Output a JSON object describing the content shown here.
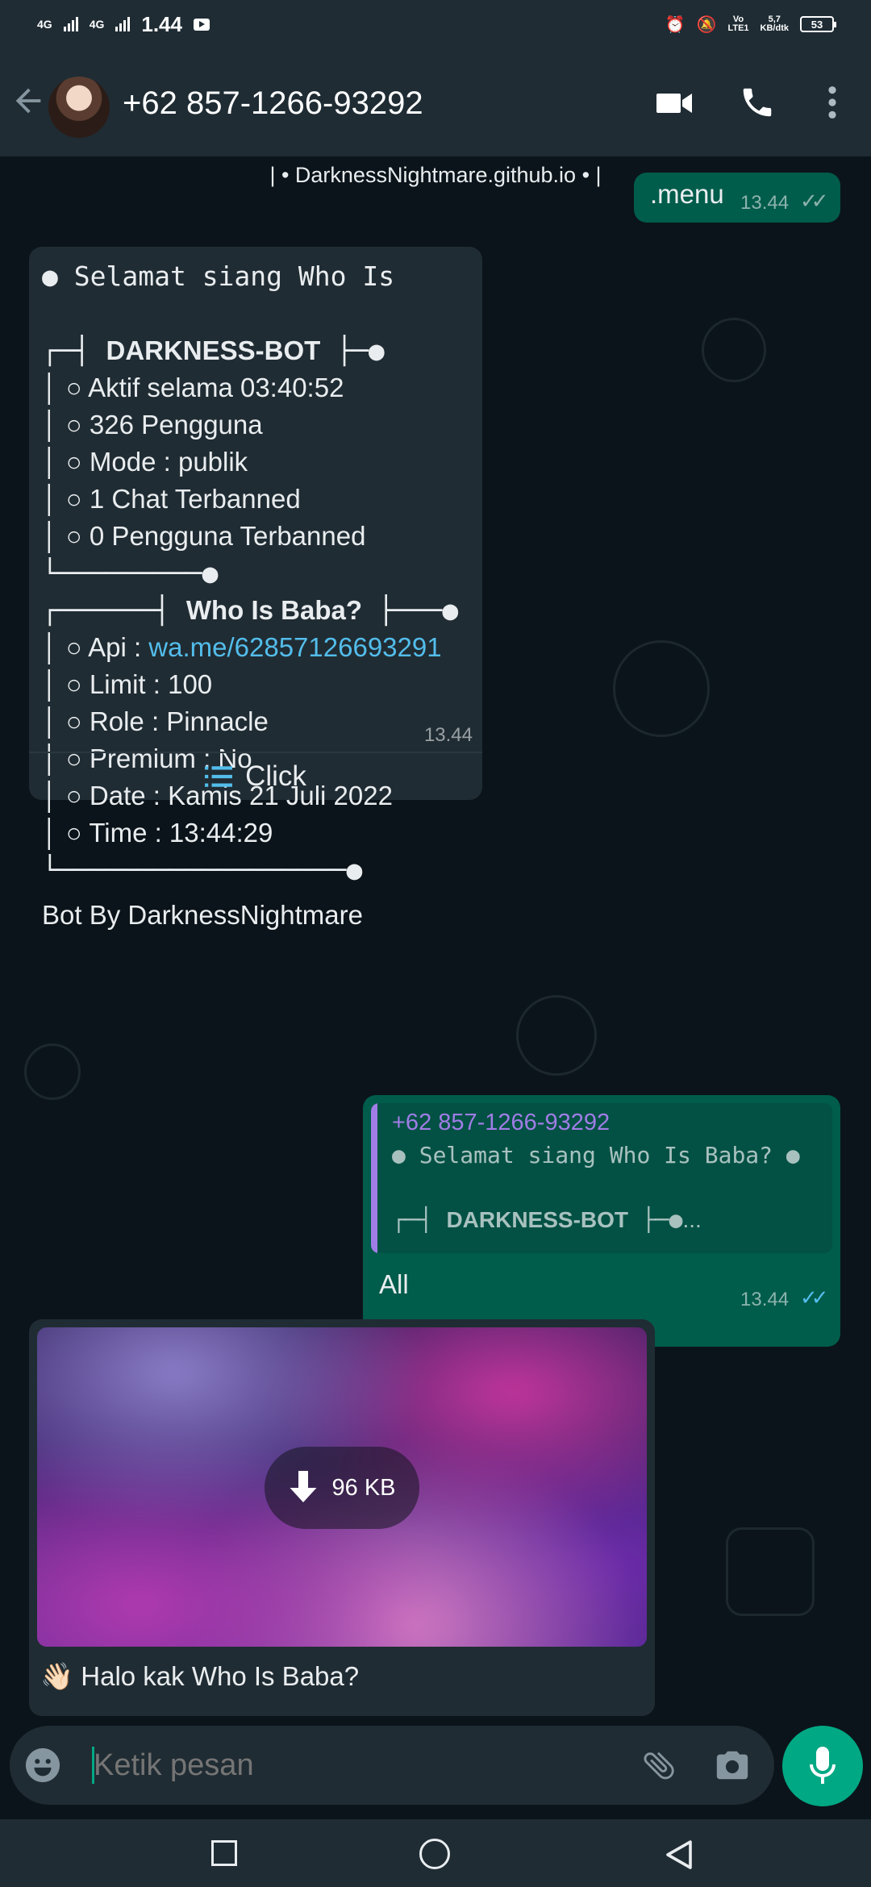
{
  "status_bar": {
    "network_1": "4G",
    "network_2": "4G",
    "time": "1.44",
    "volte_label": "Vo\nLTE1",
    "speed_label": "5,7\nKB/dtk",
    "battery": "53"
  },
  "header": {
    "contact": "+62 857-1266-93292"
  },
  "banner": "| • DarknessNightmare.github.io • |",
  "outgoing_menu": {
    "text": ".menu",
    "time": "13.44"
  },
  "bot_menu": {
    "greeting": "Selamat siang Who Is",
    "section1_title": "DARKNESS-BOT",
    "section1_lines": [
      "Aktif selama 03:40:52",
      "326 Pengguna",
      "Mode : publik",
      "1 Chat Terbanned",
      "0 Pengguna Terbanned"
    ],
    "section2_title": "Who Is Baba?",
    "api_label": "Api : ",
    "api_link": "wa.me/62857126693291",
    "section2_lines": [
      "Limit : 100",
      "Role : Pinnacle",
      "Premium : No",
      "Date : Kamis 21 Juli 2022",
      "Time : 13:44:29"
    ],
    "footer": "Bot By DarknessNightmare",
    "time": "13.44",
    "button_label": "Click"
  },
  "reply_message": {
    "quoted_sender": "+62 857-1266-93292",
    "quoted_line1": "Selamat siang Who Is Baba?",
    "quoted_line2_title": "DARKNESS-BOT",
    "quoted_ellipsis": "...",
    "text": "All",
    "time": "13.44"
  },
  "image_message": {
    "download_size": "96 KB",
    "caption": "Halo kak Who Is Baba?",
    "caption_emoji": "👋🏻"
  },
  "input": {
    "placeholder": "Ketik pesan"
  },
  "colors": {
    "bar": "#1f2c34",
    "chat_bg": "#0b141a",
    "incoming": "#202c33",
    "outgoing": "#005c4b",
    "accent": "#00a884",
    "link": "#53bdeb",
    "quote_bar": "#a07de6"
  }
}
